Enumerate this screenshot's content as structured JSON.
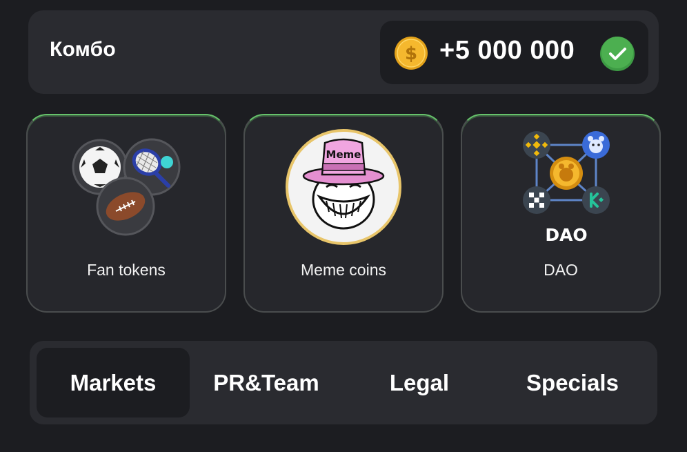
{
  "combo": {
    "title": "Комбо",
    "reward": "+5 000 000",
    "coin_icon": "dollar-coin-icon",
    "status_icon": "check-circle-icon",
    "status_color": "#4caf50"
  },
  "cards": [
    {
      "label": "Fan tokens",
      "icon": "sports-balls-icon"
    },
    {
      "label": "Meme coins",
      "icon": "troll-meme-hat-icon",
      "hat_text": "Meme"
    },
    {
      "label": "DAO",
      "icon": "dao-network-icon",
      "logo_text": "DAO"
    }
  ],
  "tabs": [
    {
      "label": "Markets",
      "active": true
    },
    {
      "label": "PR&Team",
      "active": false
    },
    {
      "label": "Legal",
      "active": false
    },
    {
      "label": "Specials",
      "active": false
    }
  ],
  "colors": {
    "background": "#1c1d21",
    "panel": "#2a2b30",
    "card_border_highlight": "#66c26b",
    "coin_gold": "#f5b82e"
  }
}
